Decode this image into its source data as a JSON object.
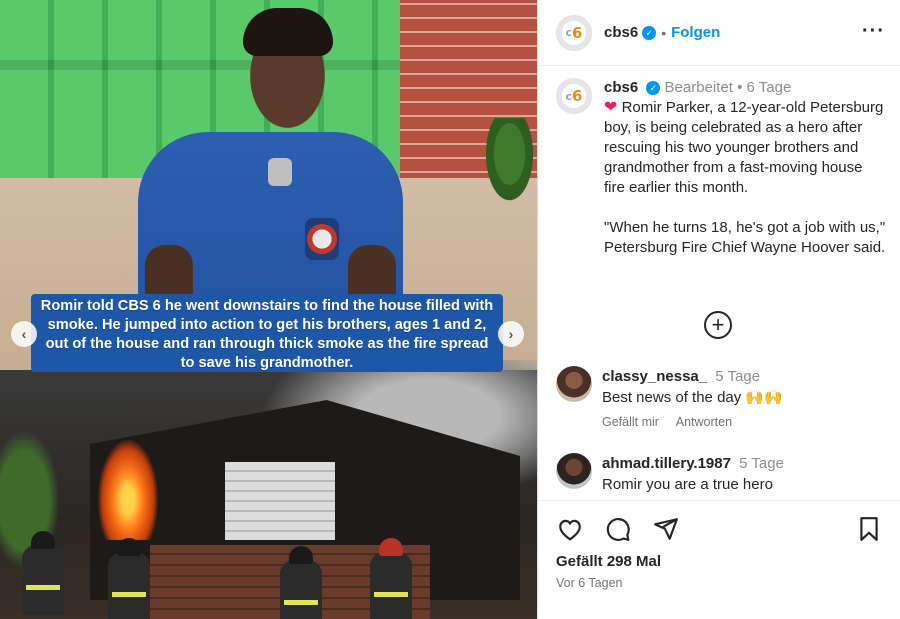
{
  "media": {
    "overlay_caption": "Romir told CBS 6 he went downstairs to find the house filled with smoke. He jumped into action to get his brothers, ages 1 and 2, out of the house and ran through thick smoke as the fire spread to save his grandmother.",
    "prev_glyph": "‹",
    "next_glyph": "›"
  },
  "header": {
    "username": "cbs6",
    "verified_glyph": "✓",
    "separator": "•",
    "follow_label": "Folgen",
    "more_glyph": "···",
    "avatar_text_c": "c",
    "avatar_text_num": "6"
  },
  "caption": {
    "username": "cbs6",
    "edited": "Bearbeitet",
    "separator": "•",
    "age": "6 Tage",
    "heart": "❤",
    "paragraph1": "Romir Parker, a 12-year-old Petersburg boy, is being celebrated as a hero after rescuing his two younger brothers and grandmother from a fast-moving house fire earlier this month.",
    "paragraph2": "\"When he turns 18, he's got a job with us,\" Petersburg Fire Chief Wayne Hoover said."
  },
  "load_more": {
    "glyph": "+"
  },
  "comments": [
    {
      "username": "classy_nessa_",
      "age": "5 Tage",
      "text": "Best news of the day",
      "emoji": "🙌🙌",
      "like_label": "Gefällt mir",
      "reply_label": "Antworten"
    },
    {
      "username": "ahmad.tillery.1987",
      "age": "5 Tage",
      "text": "Romir you are a true hero"
    }
  ],
  "footer": {
    "likes": "Gefällt 298 Mal",
    "time": "Vor 6 Tagen"
  },
  "icons": [
    "heart-icon",
    "comment-icon",
    "share-icon",
    "bookmark-icon",
    "add-circle-icon",
    "more-icon",
    "verified-icon"
  ],
  "colors": {
    "accent": "#0095f6",
    "caption_bg": "#1f57a8",
    "heart": "#e0245e",
    "brand_orange": "#f08a12"
  }
}
